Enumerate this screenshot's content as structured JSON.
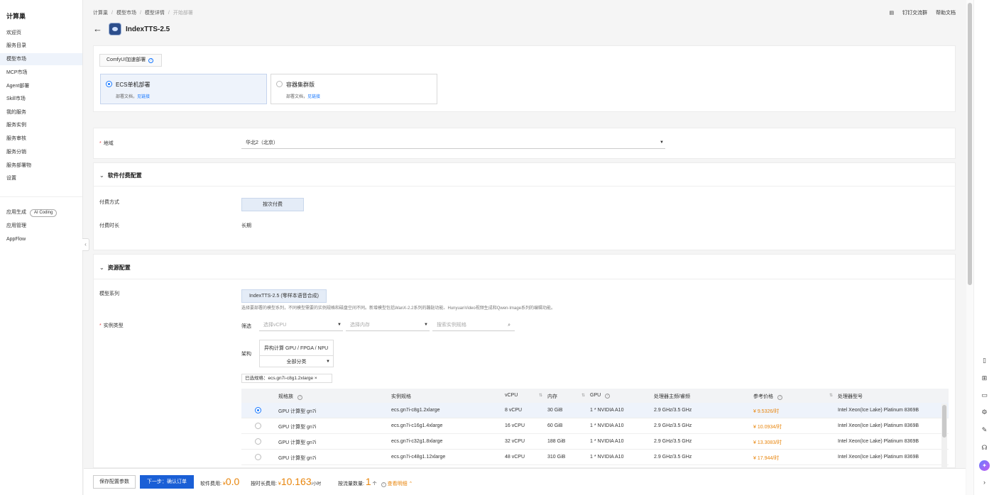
{
  "sidebar": {
    "brand": "计算巢",
    "items": [
      "欢迎页",
      "服务目录",
      "模型市场",
      "MCP市场",
      "Agent部署",
      "Skill市场",
      "我的服务",
      "服务实例",
      "服务审核",
      "服务分销",
      "服务部署物",
      "设置"
    ],
    "active_index": 2,
    "apps": {
      "item1": "应用生成",
      "item1_badge": "AI Coding",
      "item2": "应用管理",
      "item3": "AppFlow"
    },
    "collapse_icon": "chevron-left-icon"
  },
  "header": {
    "breadcrumb": [
      "计算巢",
      "模型市场",
      "模型详情",
      "开始部署"
    ],
    "links": {
      "dingtalk": "钉钉交流群",
      "help": "帮助文档"
    },
    "title": "IndexTTS-2.5"
  },
  "deploy": {
    "comfy_button": "ComfyUI加速部署",
    "options": [
      {
        "title": "ECS单机部署",
        "desc": "部署文档，",
        "link": "见链接",
        "selected": true
      },
      {
        "title": "容器集群版",
        "desc": "部署文档，",
        "link": "见链接",
        "selected": false
      }
    ]
  },
  "region": {
    "label": "地域",
    "value": "华北2（北京）"
  },
  "payment": {
    "section_title": "软件付费配置",
    "method_label": "付费方式",
    "method_value": "按次付费",
    "duration_label": "付费时长",
    "duration_value": "长期"
  },
  "resource": {
    "section_title": "资源配置",
    "model_series_label": "模型系列",
    "model_series_value": "IndexTTS-2.5 (零样本语音合成)",
    "hint": "选择要部署的模型系列，不同模型需要的实例规格和磁盘空间不同。新增模型包括WanX-2.2系列的蹦跶功能、HunyuanVideo视频生成和Qwen-Image系列的编辑功能。",
    "instance_type_label": "实例类型",
    "filter_label": "筛选",
    "filter_vcpu_placeholder": "选择vCPU",
    "filter_mem_placeholder": "选择内存",
    "search_placeholder": "搜索实例规格",
    "arch_label": "架构",
    "arch_value": "异构计算 GPU / FPGA / NPU",
    "arch_category": "全部分类",
    "chosen": "已选规格：ecs.gn7i-c8g1.2xlarge"
  },
  "table": {
    "headers": [
      "规格族",
      "实例规格",
      "vCPU",
      "内存",
      "GPU",
      "处理器主频/睿频",
      "参考价格",
      "处理器型号"
    ],
    "rows": [
      {
        "family": "GPU 计算型 gn7i",
        "spec": "ecs.gn7i-c8g1.2xlarge",
        "vcpu": "8 vCPU",
        "mem": "30 GiB",
        "gpu": "1 * NVIDIA A10",
        "freq": "2.9 GHz/3.5 GHz",
        "price": "¥ 9.5326/时",
        "cpu": "Intel Xeon(Ice Lake) Platinum 8369B",
        "selected": true
      },
      {
        "family": "GPU 计算型 gn7i",
        "spec": "ecs.gn7i-c16g1.4xlarge",
        "vcpu": "16 vCPU",
        "mem": "60 GiB",
        "gpu": "1 * NVIDIA A10",
        "freq": "2.9 GHz/3.5 GHz",
        "price": "¥ 10.0934/时",
        "cpu": "Intel Xeon(Ice Lake) Platinum 8369B",
        "selected": false
      },
      {
        "family": "GPU 计算型 gn7i",
        "spec": "ecs.gn7i-c32g1.8xlarge",
        "vcpu": "32 vCPU",
        "mem": "188 GiB",
        "gpu": "1 * NVIDIA A10",
        "freq": "2.9 GHz/3.5 GHz",
        "price": "¥ 13.3083/时",
        "cpu": "Intel Xeon(Ice Lake) Platinum 8369B",
        "selected": false
      },
      {
        "family": "GPU 计算型 gn7i",
        "spec": "ecs.gn7i-c48g1.12xlarge",
        "vcpu": "48 vCPU",
        "mem": "310 GiB",
        "gpu": "1 * NVIDIA A10",
        "freq": "2.9 GHz/3.5 GHz",
        "price": "¥ 17.944/时",
        "cpu": "Intel Xeon(Ice Lake) Platinum 8369B",
        "selected": false
      }
    ]
  },
  "footer": {
    "save_label": "保存配置参数",
    "next_label": "下一步：确认订单",
    "software_fee_label": "软件费用:",
    "software_fee_currency": "¥",
    "software_fee_value": "0.0",
    "hourly_fee_label": "按时长费用:",
    "hourly_fee_currency": "¥",
    "hourly_fee_value": "10.163",
    "hourly_fee_unit": "/小时",
    "traffic_label": "按流量数量:",
    "traffic_value": "1",
    "traffic_unit": "个",
    "detail_link": "查看明细"
  },
  "rail_icons": [
    "phone-icon",
    "calculator-icon",
    "message-icon",
    "settings-icon",
    "edit-icon",
    "headset-icon",
    "ai-assistant-icon",
    "chevron-right-icon"
  ],
  "colors": {
    "accent": "#1a5fd6",
    "price": "#e8850c",
    "selected_bg": "#eef3fb"
  }
}
